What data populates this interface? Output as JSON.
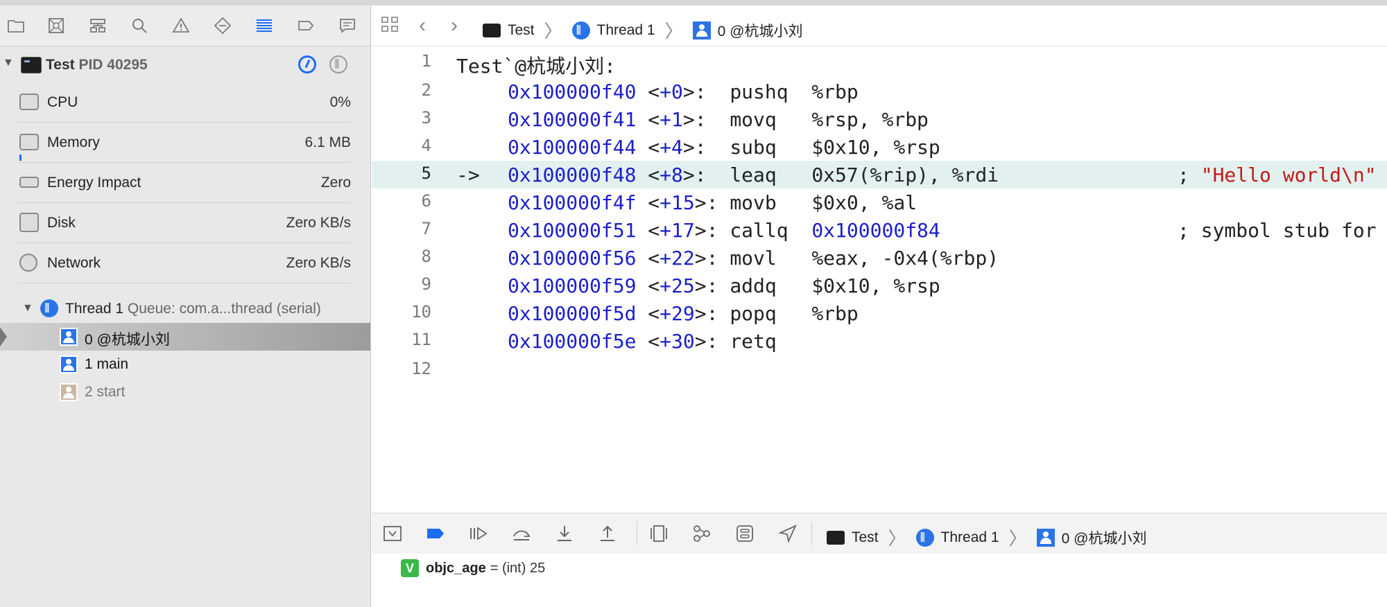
{
  "navigator": {
    "process": {
      "name": "Test",
      "pid_label": "PID 40295"
    },
    "gauges": [
      {
        "label": "CPU",
        "value": "0%"
      },
      {
        "label": "Memory",
        "value": "6.1 MB"
      },
      {
        "label": "Energy Impact",
        "value": "Zero"
      },
      {
        "label": "Disk",
        "value": "Zero KB/s"
      },
      {
        "label": "Network",
        "value": "Zero KB/s"
      }
    ],
    "thread": {
      "name": "Thread 1",
      "queue": "Queue: com.a...thread (serial)"
    },
    "frames": [
      {
        "label": "0 @杭城小刘"
      },
      {
        "label": "1 main"
      },
      {
        "label": "2 start"
      }
    ]
  },
  "jumpbar": {
    "crumbs": [
      "Test",
      "Thread 1",
      "0 @杭城小刘"
    ]
  },
  "code": {
    "header": "Test`@杭城小刘:",
    "lines": [
      {
        "num": "1"
      },
      {
        "num": "2",
        "addr": "0x100000f40",
        "off": "+0",
        "mnemonic": "pushq",
        "operands": "%rbp"
      },
      {
        "num": "3",
        "addr": "0x100000f41",
        "off": "+1",
        "mnemonic": "movq",
        "operands": "%rsp, %rbp"
      },
      {
        "num": "4",
        "addr": "0x100000f44",
        "off": "+4",
        "mnemonic": "subq",
        "operands": "$0x10, %rsp"
      },
      {
        "num": "5",
        "addr": "0x100000f48",
        "off": "+8",
        "mnemonic": "leaq",
        "operands": "0x57(%rip), %rdi",
        "comment_prefix": ";",
        "comment": "\"Hello world\\n\"",
        "marker": "->"
      },
      {
        "num": "6",
        "addr": "0x100000f4f",
        "off": "+15",
        "mnemonic": "movb",
        "operands": "$0x0, %al"
      },
      {
        "num": "7",
        "addr": "0x100000f51",
        "off": "+17",
        "mnemonic": "callq",
        "operands": "0x100000f84",
        "comment_prefix": ";",
        "comment": "symbol stub for"
      },
      {
        "num": "8",
        "addr": "0x100000f56",
        "off": "+22",
        "mnemonic": "movl",
        "operands": "%eax, -0x4(%rbp)"
      },
      {
        "num": "9",
        "addr": "0x100000f59",
        "off": "+25",
        "mnemonic": "addq",
        "operands": "$0x10, %rsp"
      },
      {
        "num": "10",
        "addr": "0x100000f5d",
        "off": "+29",
        "mnemonic": "popq",
        "operands": "%rbp"
      },
      {
        "num": "11",
        "addr": "0x100000f5e",
        "off": "+30",
        "mnemonic": "retq",
        "operands": ""
      },
      {
        "num": "12"
      }
    ]
  },
  "debugbar": {
    "crumbs": [
      "Test",
      "Thread 1",
      "0 @杭城小刘"
    ]
  },
  "variables": [
    {
      "badge": "V",
      "name": "objc_age",
      "rest": "= (int) 25"
    }
  ],
  "colors": {
    "accent": "#1a6ef5",
    "address": "#1b1fc7",
    "string": "#c41a16",
    "current_line": "#e2f1f0"
  }
}
